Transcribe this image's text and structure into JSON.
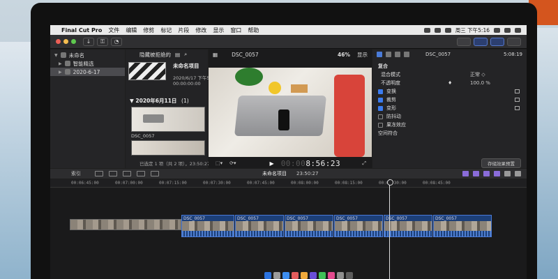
{
  "menubar": {
    "app_name": "Final Cut Pro",
    "items": [
      "文件",
      "编辑",
      "修剪",
      "标记",
      "片段",
      "修改",
      "显示",
      "窗口",
      "帮助"
    ],
    "clock": "周三 下午5:16"
  },
  "libraries": {
    "library_name": "未命名",
    "smart_collections": "智能精选",
    "event_name": "2020-6-17"
  },
  "browser": {
    "filter_label": "隐藏被拒绝的",
    "project_title": "未命名项目",
    "project_date": "2020/6/17 下午5:1",
    "project_duration": "00:00:00:00",
    "date_group_label": "2020年6月11日",
    "date_group_count": "(1)",
    "clip_name": "DSC_0057",
    "selection_info": "已选定 1 项（共 2 项），23:50:27"
  },
  "viewer": {
    "clip_name": "DSC_0057",
    "zoom": "46%",
    "display_menu": "显示",
    "timecode_dim": "00:00",
    "timecode": "8:56:23"
  },
  "inspector": {
    "clip_name": "DSC_0057",
    "duration": "5:08:19",
    "rows": [
      {
        "label": "复合",
        "value": "",
        "checkbox": null,
        "section": true
      },
      {
        "label": "混合模式",
        "value": "正常 ◇",
        "checkbox": null,
        "section": false
      },
      {
        "label": "不透明度",
        "value": "100.0  %",
        "checkbox": null,
        "section": false
      },
      {
        "label": "变换",
        "value": "",
        "checkbox": true,
        "section": false
      },
      {
        "label": "裁剪",
        "value": "",
        "checkbox": true,
        "section": false
      },
      {
        "label": "变形",
        "value": "",
        "checkbox": true,
        "section": false
      },
      {
        "label": "防抖动",
        "value": "",
        "checkbox": false,
        "section": false
      },
      {
        "label": "果冻效应",
        "value": "",
        "checkbox": false,
        "section": false
      },
      {
        "label": "空间符合",
        "value": "",
        "checkbox": null,
        "section": false
      }
    ],
    "save_preset": "存储效果预置"
  },
  "timeline": {
    "index_label": "索引",
    "project_title": "未命名项目",
    "project_duration": "23:50:27",
    "ruler": [
      "00:06:45:00",
      "00:07:00:00",
      "00:07:15:00",
      "00:07:30:00",
      "00:07:45:00",
      "00:08:00:00",
      "00:08:15:00",
      "00:08:30:00",
      "00:08:45:00"
    ],
    "clip_labels": [
      "DSC_0057",
      "DSC_0057",
      "DSC_0057",
      "DSC_0057",
      "DSC_0057",
      "DSC_0057"
    ]
  },
  "colors": {
    "accent_blue": "#4a7bd8",
    "clip_blue": "#1c3f78",
    "purple_tool": "#8a6cd9"
  }
}
